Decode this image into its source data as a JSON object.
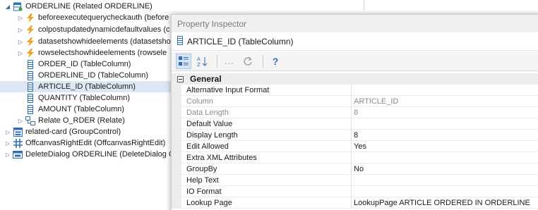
{
  "tree": {
    "root": {
      "label": "ORDERLINE (Related ORDERLINE)"
    },
    "items": [
      {
        "label": "beforeexecutequerycheckauth (before",
        "icon": "lightning-icon"
      },
      {
        "label": "colpostupdatedynamicdefaultvalues (c",
        "icon": "lightning-icon"
      },
      {
        "label": "datasetshowhideelements (datasetsho",
        "icon": "lightning-icon"
      },
      {
        "label": "rowselectshowhideelements (rowsele",
        "icon": "lightning-icon"
      },
      {
        "label": "ORDER_ID (TableColumn)",
        "icon": "column-icon"
      },
      {
        "label": "ORDERLINE_ID (TableColumn)",
        "icon": "column-icon"
      },
      {
        "label": "ARTICLE_ID (TableColumn)",
        "icon": "column-icon"
      },
      {
        "label": "QUANTITY (TableColumn)",
        "icon": "column-icon"
      },
      {
        "label": "AMOUNT (TableColumn)",
        "icon": "column-icon"
      },
      {
        "label": "Relate O_RDER (Relate)",
        "icon": "relate-icon"
      }
    ],
    "top_level": [
      {
        "label": "related-card (GroupControl)",
        "icon": "group-control-icon"
      },
      {
        "label": "OffcanvasRightEdit (OffcanvasRightEdit)",
        "icon": "offcanvas-icon"
      },
      {
        "label": "DeleteDialog ORDERLINE (DeleteDialog ORD",
        "icon": "dialog-icon"
      }
    ]
  },
  "inspector": {
    "title": "Property Inspector",
    "selected": "ARTICLE_ID (TableColumn)",
    "toolbar": {
      "categorized": "categorized-view",
      "sort": "A-Z sort",
      "more": "...",
      "help": "?"
    },
    "category": "General",
    "properties": [
      {
        "name": "Alternative Input Format",
        "value": "",
        "readonly": false
      },
      {
        "name": "Column",
        "value": "ARTICLE_ID",
        "readonly": true
      },
      {
        "name": "Data Length",
        "value": "8",
        "readonly": true
      },
      {
        "name": "Default Value",
        "value": "",
        "readonly": false
      },
      {
        "name": "Display Length",
        "value": "8",
        "readonly": false
      },
      {
        "name": "Edit Allowed",
        "value": "Yes",
        "readonly": false
      },
      {
        "name": "Extra XML Attributes",
        "value": "",
        "readonly": false
      },
      {
        "name": "GroupBy",
        "value": "No",
        "readonly": false
      },
      {
        "name": "Help Text",
        "value": "",
        "readonly": false
      },
      {
        "name": "IO Format",
        "value": "",
        "readonly": false
      },
      {
        "name": "Lookup Page",
        "value": "LookupPage ARTICLE ORDERED IN ORDERLINE",
        "readonly": false
      }
    ]
  },
  "colors": {
    "selection": "#dde6f3",
    "accent": "#2f6fb5",
    "lightning": "#f0a020",
    "readonly": "#8a8a8a"
  }
}
